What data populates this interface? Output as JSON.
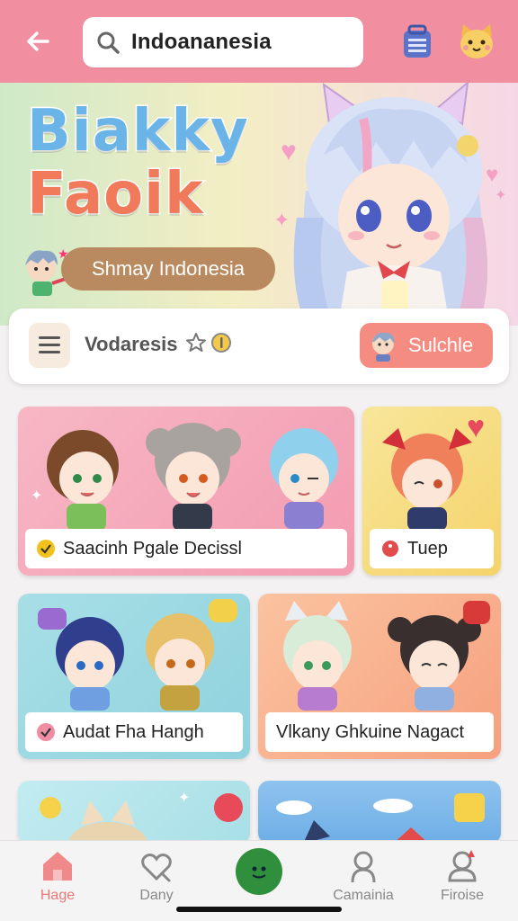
{
  "header": {
    "back_icon": "arrow-left-icon",
    "search_value": "Indoananesia",
    "search_icon": "search-icon",
    "right_icons": [
      "backpack-icon",
      "cat-avatar-icon"
    ],
    "bar_color": "#f18fa0"
  },
  "hero": {
    "logo_line1": "Biakky",
    "logo_line2": "Faoik",
    "tagline": "Shmay Indonesia"
  },
  "channel": {
    "menu_icon": "list-icon",
    "name": "Vodaresis",
    "badge_icons": [
      "star-icon",
      "coin-icon"
    ],
    "subscribe_label": "Sulchle"
  },
  "cards": [
    {
      "caption": "Saacinh Pgale Decissl",
      "icon": "check-badge-icon",
      "bg": "#f4a3b6"
    },
    {
      "caption": "Tuep",
      "icon": "red-dot-icon",
      "bg": "#f7e08a"
    },
    {
      "caption": "Audat Fha Hangh",
      "icon": "check-badge-icon",
      "bg": "#9ed9e2"
    },
    {
      "caption": "Vlkany Ghkuine Nagact",
      "icon": "",
      "bg": "#f8a98a"
    },
    {
      "caption": "",
      "icon": "",
      "bg": "#b9e6ee"
    },
    {
      "caption": "",
      "icon": "",
      "bg": "#7fb7e8"
    }
  ],
  "bottom_nav": [
    {
      "label": "Hage",
      "icon": "home-icon",
      "active": true
    },
    {
      "label": "Dany",
      "icon": "heart-search-icon",
      "active": false
    },
    {
      "label": "",
      "icon": "smiley-icon",
      "active": false
    },
    {
      "label": "Camainia",
      "icon": "person-icon",
      "active": false
    },
    {
      "label": "Firoise",
      "icon": "profile-icon",
      "active": false
    }
  ]
}
